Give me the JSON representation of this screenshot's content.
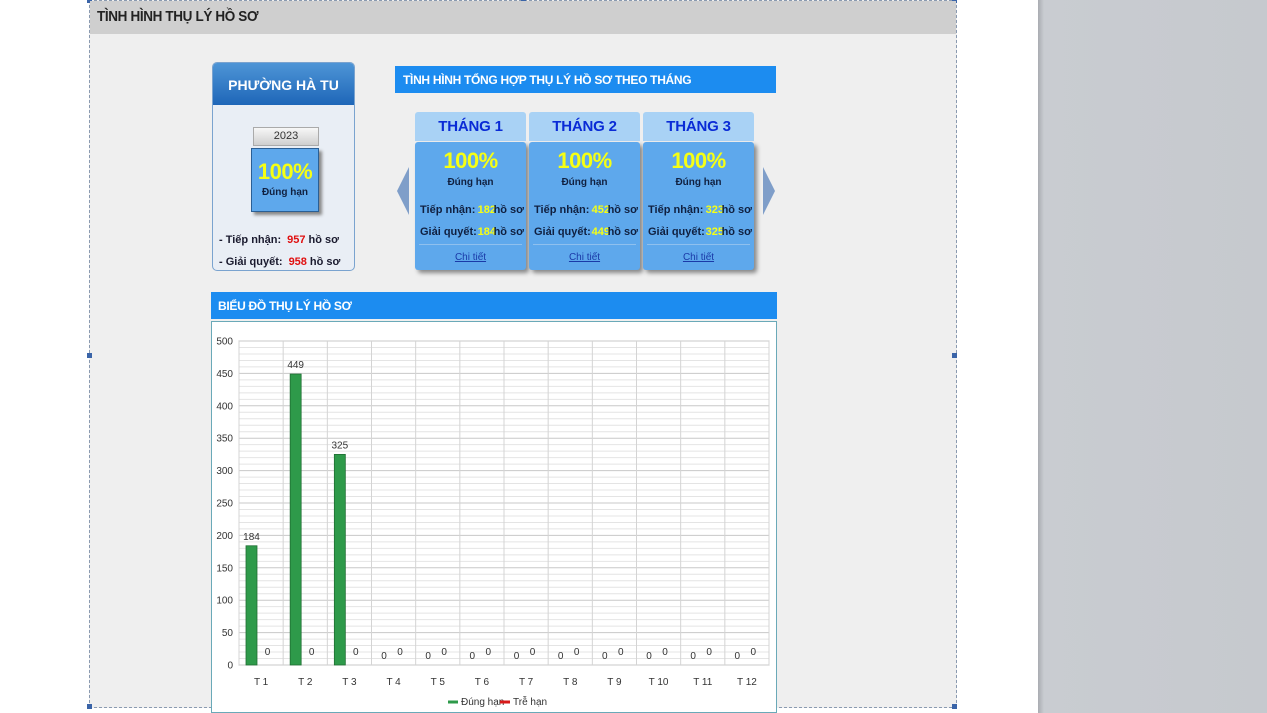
{
  "page": {
    "title": "TÌNH HÌNH THỤ LÝ HỒ SƠ"
  },
  "ward": {
    "name": "PHƯỜNG HÀ TU",
    "year": "2023",
    "percent": "100%",
    "status": "Đúng hạn",
    "received_label": "- Tiếp nhận:",
    "received_value": "957",
    "resolved_label": "- Giải quyết:",
    "resolved_value": "958",
    "unit": "hồ sơ"
  },
  "summary": {
    "title": "TÌNH HÌNH TỔNG HỢP THỤ LÝ HỒ SƠ THEO THÁNG",
    "months": [
      {
        "name": "THÁNG 1",
        "percent": "100%",
        "status": "Đúng hạn",
        "received_label": "Tiếp nhận:",
        "received": "182",
        "resolved_label": "Giải quyết:",
        "resolved": "184",
        "unit": "hồ sơ",
        "link": "Chi tiết"
      },
      {
        "name": "THÁNG 2",
        "percent": "100%",
        "status": "Đúng hạn",
        "received_label": "Tiếp nhận:",
        "received": "452",
        "resolved_label": "Giải quyết:",
        "resolved": "449",
        "unit": "hồ sơ",
        "link": "Chi tiết"
      },
      {
        "name": "THÁNG 3",
        "percent": "100%",
        "status": "Đúng hạn",
        "received_label": "Tiếp nhận:",
        "received": "323",
        "resolved_label": "Giải quyết:",
        "resolved": "325",
        "unit": "hồ sơ",
        "link": "Chi tiết"
      }
    ]
  },
  "chart": {
    "title": "BIỂU ĐỒ THỤ LÝ HỒ SƠ"
  },
  "chart_data": {
    "type": "bar",
    "categories": [
      "T 1",
      "T 2",
      "T 3",
      "T 4",
      "T 5",
      "T 6",
      "T 7",
      "T 8",
      "T 9",
      "T 10",
      "T 11",
      "T 12"
    ],
    "series": [
      {
        "name": "Đúng hạn",
        "color": "#2e9a4a",
        "values": [
          184,
          449,
          325,
          0,
          0,
          0,
          0,
          0,
          0,
          0,
          0,
          0
        ]
      },
      {
        "name": "Trễ hạn",
        "color": "#d81a1a",
        "values": [
          0,
          0,
          0,
          0,
          0,
          0,
          0,
          0,
          0,
          0,
          0,
          0
        ]
      }
    ],
    "ylim": [
      0,
      500
    ],
    "yticks": [
      0,
      50,
      100,
      150,
      200,
      250,
      300,
      350,
      400,
      450,
      500
    ],
    "grid": true,
    "legend": "bottom"
  },
  "colors": {
    "accent": "#1c8cf0",
    "card": "#5ea8ec",
    "highlight": "#f6ff14"
  }
}
